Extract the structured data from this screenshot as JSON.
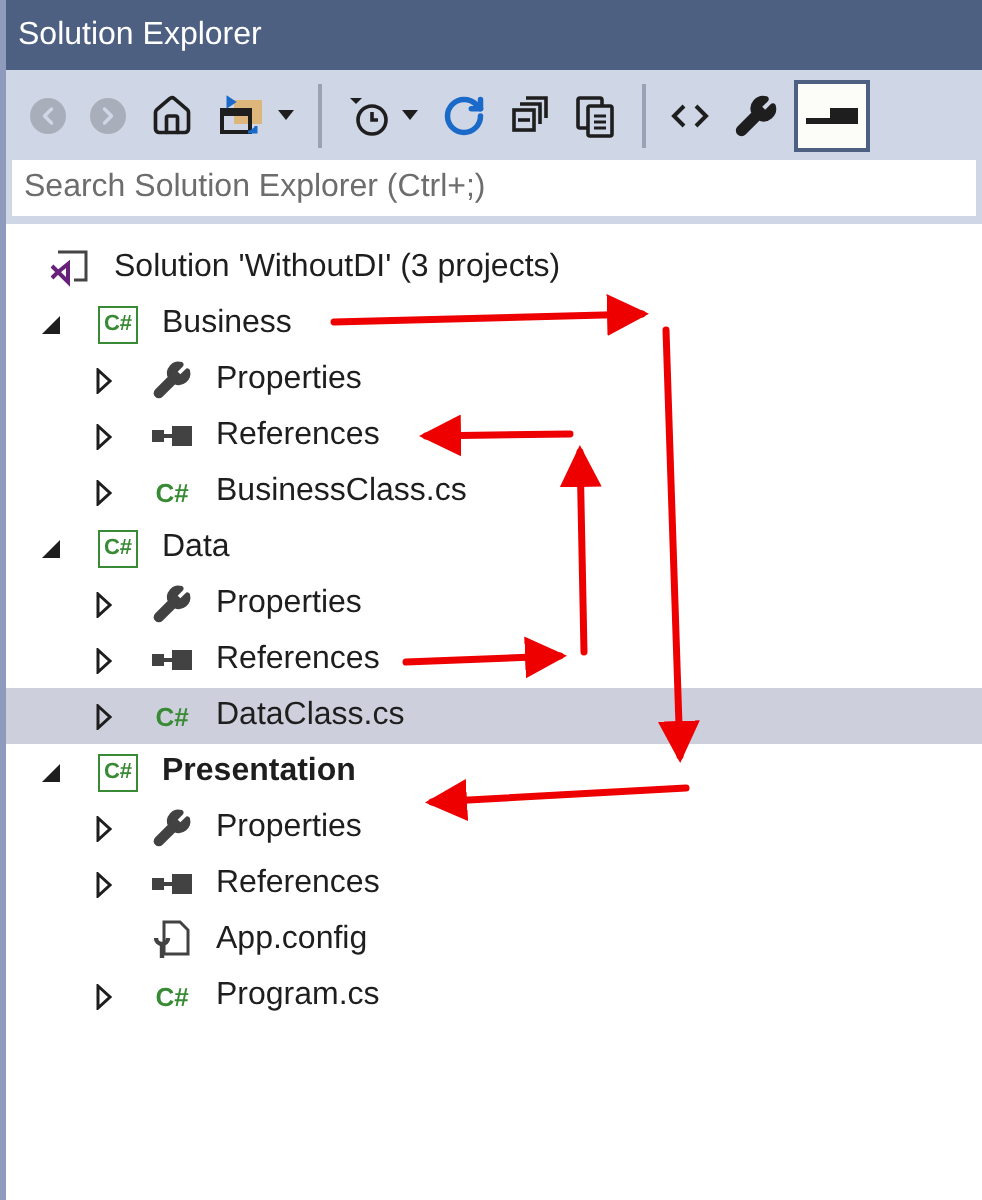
{
  "window": {
    "title": "Solution Explorer"
  },
  "toolbar": [
    {
      "kind": "back",
      "disabled": true
    },
    {
      "kind": "forward",
      "disabled": true
    },
    {
      "kind": "home",
      "disabled": false
    },
    {
      "kind": "sync",
      "disabled": false,
      "dropdown": true
    },
    {
      "kind": "separator"
    },
    {
      "kind": "pending",
      "disabled": false,
      "dropdown": true
    },
    {
      "kind": "refresh",
      "disabled": false
    },
    {
      "kind": "collapse",
      "disabled": false
    },
    {
      "kind": "copy",
      "disabled": false
    },
    {
      "kind": "separator"
    },
    {
      "kind": "code",
      "disabled": false
    },
    {
      "kind": "wrench",
      "disabled": false
    },
    {
      "kind": "preview",
      "disabled": false,
      "selected": true
    }
  ],
  "search": {
    "placeholder": "Search Solution Explorer (Ctrl+;)"
  },
  "tree": {
    "kind": "solution",
    "label": "Solution 'WithoutDI' (3 projects)",
    "selected": false,
    "children": [
      {
        "kind": "project",
        "badge": "C#",
        "label": "Business",
        "expanded": true,
        "startup": false,
        "selected": false,
        "children": [
          {
            "kind": "properties",
            "label": "Properties",
            "expanded": false,
            "selected": false
          },
          {
            "kind": "references",
            "label": "References",
            "expanded": false,
            "selected": false
          },
          {
            "kind": "csfile",
            "badge": "C#",
            "label": "BusinessClass.cs",
            "expanded": false,
            "selected": false
          }
        ]
      },
      {
        "kind": "project",
        "badge": "C#",
        "label": "Data",
        "expanded": true,
        "startup": false,
        "selected": false,
        "children": [
          {
            "kind": "properties",
            "label": "Properties",
            "expanded": false,
            "selected": false
          },
          {
            "kind": "references",
            "label": "References",
            "expanded": false,
            "selected": false
          },
          {
            "kind": "csfile",
            "badge": "C#",
            "label": "DataClass.cs",
            "expanded": false,
            "selected": true
          }
        ]
      },
      {
        "kind": "project",
        "badge": "C#",
        "label": "Presentation",
        "expanded": true,
        "startup": true,
        "selected": false,
        "children": [
          {
            "kind": "properties",
            "label": "Properties",
            "expanded": false,
            "selected": false
          },
          {
            "kind": "references",
            "label": "References",
            "expanded": false,
            "selected": false
          },
          {
            "kind": "config",
            "label": "App.config",
            "selected": false
          },
          {
            "kind": "csfile",
            "badge": "C#",
            "label": "Program.cs",
            "expanded": false,
            "selected": false
          }
        ]
      }
    ]
  }
}
